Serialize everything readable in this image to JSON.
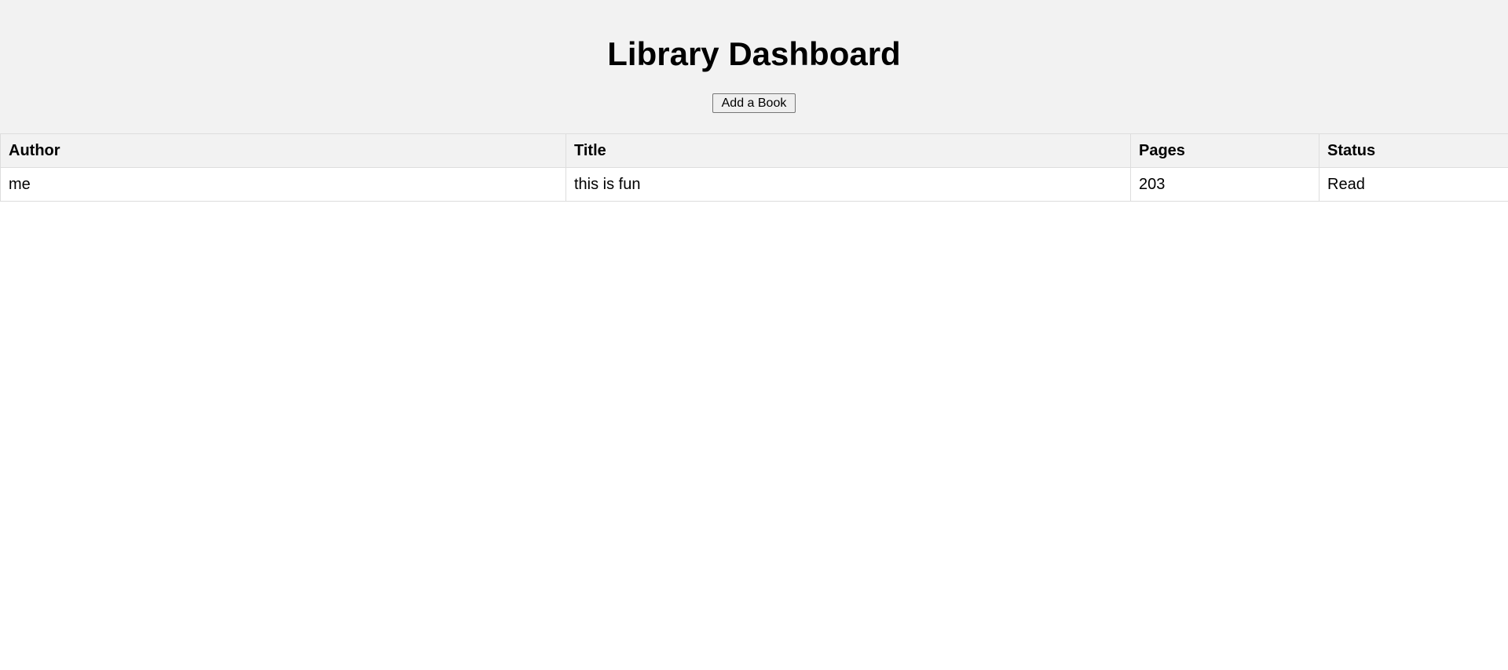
{
  "header": {
    "title": "Library Dashboard",
    "add_button_label": "Add a Book"
  },
  "table": {
    "columns": [
      "Author",
      "Title",
      "Pages",
      "Status"
    ],
    "rows": [
      {
        "author": "me",
        "title": "this is fun",
        "pages": "203",
        "status": "Read"
      }
    ]
  },
  "colors": {
    "header_background": "#f2f2f2",
    "border": "#dddddd",
    "text": "#000000"
  }
}
